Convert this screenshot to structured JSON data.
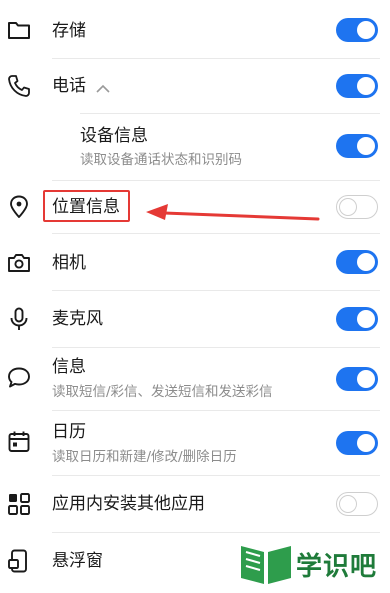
{
  "rows": [
    {
      "title": "存储",
      "icon": "folder-icon",
      "enabled": true
    },
    {
      "title": "电话",
      "icon": "phone-icon",
      "enabled": true
    },
    {
      "title": "设备信息",
      "subtitle": "读取设备通话状态和识别码",
      "enabled": true
    },
    {
      "title": "位置信息",
      "icon": "location-pin-icon",
      "enabled": false
    },
    {
      "title": "相机",
      "icon": "camera-icon",
      "enabled": true
    },
    {
      "title": "麦克风",
      "icon": "microphone-icon",
      "enabled": true
    },
    {
      "title": "信息",
      "subtitle": "读取短信/彩信、发送短信和发送彩信",
      "icon": "message-bubble-icon",
      "enabled": true
    },
    {
      "title": "日历",
      "subtitle": "读取日历和新建/修改/删除日历",
      "icon": "calendar-icon",
      "enabled": true
    },
    {
      "title": "应用内安装其他应用",
      "icon": "apps-grid-icon",
      "enabled": false
    },
    {
      "title": "悬浮窗",
      "icon": "floating-window-icon",
      "enabled": true
    }
  ],
  "annotation": {
    "color": "#e53935"
  },
  "watermark": {
    "text": "学识吧"
  },
  "colors": {
    "toggle_on": "#1e74f0",
    "toggle_off_border": "#cfcfcf"
  }
}
